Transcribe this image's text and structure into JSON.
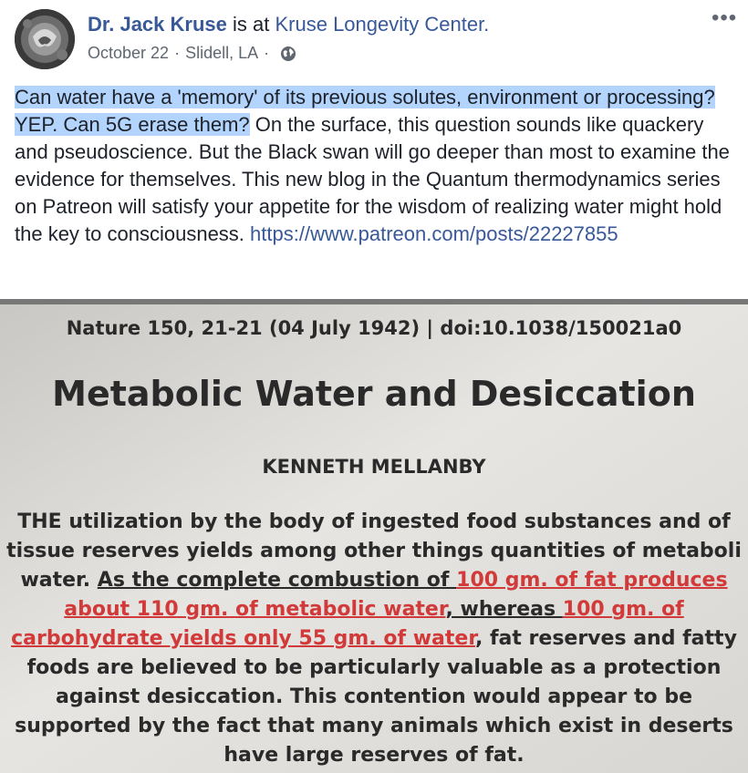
{
  "post": {
    "author": "Dr. Jack Kruse",
    "is_at": "is at",
    "location": "Kruse Longevity Center.",
    "date": "October 22",
    "city": "Slidell, LA",
    "separator": "·",
    "privacy_icon": "globe-icon",
    "more_label": "•••",
    "text_highlighted": "Can water have a 'memory' of its previous solutes, environment or processing? YEP. Can 5G erase them?",
    "text_rest": " On the surface, this question sounds like quackery and pseudoscience. But the Black swan will go deeper than most to examine the evidence for themselves. This new blog in the Quantum thermodynamics series on Patreon will satisfy your appetite for the wisdom of realizing water might hold the key to consciousness. ",
    "link": "https://www.patreon.com/posts/22227855"
  },
  "photo": {
    "citation": "Nature 150, 21-21 (04 July 1942) | doi:10.1038/150021a0",
    "title": "Metabolic Water and Desiccation",
    "author": "KENNETH MELLANBY",
    "lines": [
      {
        "parts": [
          {
            "t": "THE utilization by the body of ingested food substances and of"
          }
        ]
      },
      {
        "parts": [
          {
            "t": "tissue reserves yields among other things quantities of metaboli"
          }
        ]
      },
      {
        "parts": [
          {
            "t": "water. "
          },
          {
            "t": "As the complete combustion of ",
            "s": "u"
          },
          {
            "t": "100 gm. of fat produces",
            "s": "red"
          }
        ]
      },
      {
        "parts": [
          {
            "t": "about 110 gm. of metabolic water",
            "s": "red"
          },
          {
            "t": ", whereas ",
            "s": "u"
          },
          {
            "t": "100 gm. of",
            "s": "red"
          }
        ]
      },
      {
        "parts": [
          {
            "t": "carbohydrate yields only 55 gm. of water",
            "s": "red"
          },
          {
            "t": ", fat reserves and fatty"
          }
        ]
      },
      {
        "parts": [
          {
            "t": "foods are believed to be particularly valuable as a protection"
          }
        ]
      },
      {
        "parts": [
          {
            "t": "against desiccation. This contention would appear to be"
          }
        ]
      },
      {
        "parts": [
          {
            "t": "supported by the fact that many animals which exist in deserts"
          }
        ]
      },
      {
        "parts": [
          {
            "t": "have large reserves of fat."
          }
        ]
      }
    ]
  },
  "colors": {
    "link": "#385898",
    "highlight": "#b3d4fc",
    "annotation_red": "#d23a3a"
  }
}
